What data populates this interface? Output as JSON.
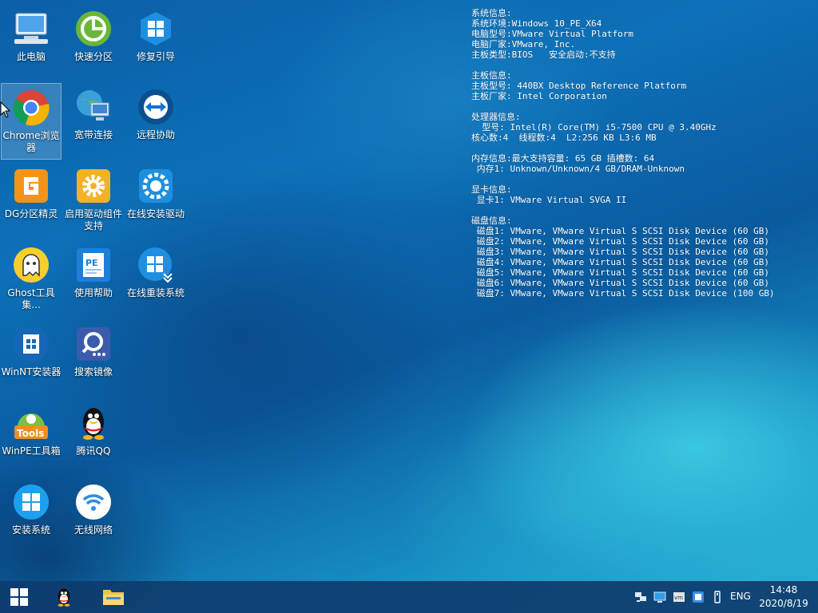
{
  "desktop": {
    "icons": [
      {
        "label": "此电脑",
        "icon": "computer-icon"
      },
      {
        "label": "快速分区",
        "icon": "partition-icon"
      },
      {
        "label": "修复引导",
        "icon": "windows-repair-icon"
      },
      {
        "label": "Chrome浏览器",
        "icon": "chrome-icon"
      },
      {
        "label": "宽带连接",
        "icon": "network-icon"
      },
      {
        "label": "远程协助",
        "icon": "teamviewer-icon"
      },
      {
        "label": "DG分区精灵",
        "icon": "diskgenius-icon"
      },
      {
        "label": "启用驱动组件支持",
        "icon": "gear-icon"
      },
      {
        "label": "在线安装驱动",
        "icon": "driver-install-icon"
      },
      {
        "label": "Ghost工具集...",
        "icon": "ghost-icon"
      },
      {
        "label": "使用帮助",
        "icon": "help-document-icon"
      },
      {
        "label": "在线重装系统",
        "icon": "windows-download-icon"
      },
      {
        "label": "WinNT安装器",
        "icon": "winnt-icon"
      },
      {
        "label": "搜索镜像",
        "icon": "search-image-icon"
      },
      {
        "label": "WinPE工具箱",
        "icon": "tools-icon"
      },
      {
        "label": "腾讯QQ",
        "icon": "qq-icon"
      },
      {
        "label": "安装系统",
        "icon": "windows-install-icon"
      },
      {
        "label": "无线网络",
        "icon": "wifi-icon"
      }
    ]
  },
  "sysinfo": {
    "text": "系统信息:\n系统环境:Windows 10_PE_X64\n电脑型号:VMware Virtual Platform\n电脑厂家:VMware, Inc.\n主板类型:BIOS   安全启动:不支持\n\n主板信息:\n主板型号: 440BX Desktop Reference Platform\n主板厂家: Intel Corporation\n\n处理器信息:\n  型号: Intel(R) Core(TM) i5-7500 CPU @ 3.40GHz\n核心数:4  线程数:4  L2:256 KB L3:6 MB\n\n内存信息:最大支持容量: 65 GB 插槽数: 64\n 内存1: Unknown/Unknown/4 GB/DRAM-Unknown\n\n显卡信息:\n 显卡1: VMware Virtual SVGA II\n\n磁盘信息:\n 磁盘1: VMware, VMware Virtual S SCSI Disk Device (60 GB)\n 磁盘2: VMware, VMware Virtual S SCSI Disk Device (60 GB)\n 磁盘3: VMware, VMware Virtual S SCSI Disk Device (60 GB)\n 磁盘4: VMware, VMware Virtual S SCSI Disk Device (60 GB)\n 磁盘5: VMware, VMware Virtual S SCSI Disk Device (60 GB)\n 磁盘6: VMware, VMware Virtual S SCSI Disk Device (60 GB)\n 磁盘7: VMware, VMware Virtual S SCSI Disk Device (100 GB)"
  },
  "taskbar": {
    "language": "ENG",
    "time": "14:48",
    "date": "2020/8/19",
    "accent": "#0e3c6e"
  }
}
